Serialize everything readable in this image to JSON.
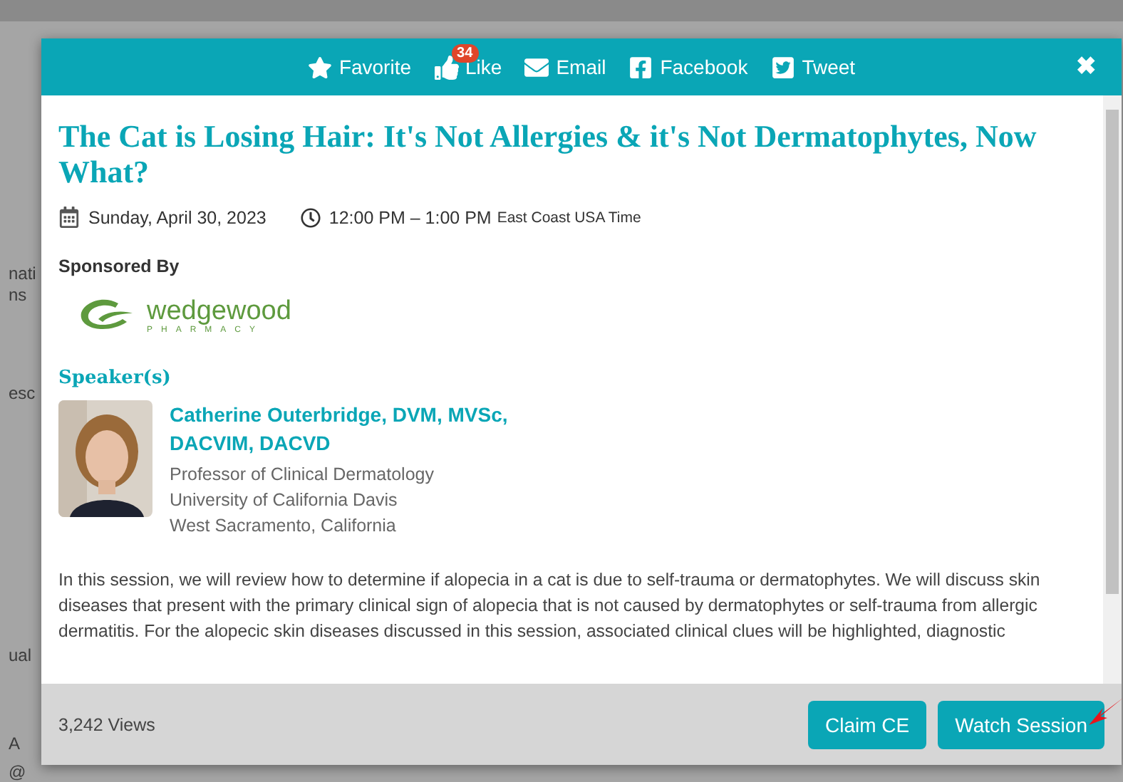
{
  "background": {
    "fragments": [
      "nati",
      "ns",
      "esc",
      "ual",
      "A",
      "@"
    ]
  },
  "modal": {
    "actions": [
      {
        "kind": "favorite",
        "label": "Favorite"
      },
      {
        "kind": "like",
        "label": "Like",
        "count": "34"
      },
      {
        "kind": "email",
        "label": "Email"
      },
      {
        "kind": "facebook",
        "label": "Facebook"
      },
      {
        "kind": "tweet",
        "label": "Tweet"
      }
    ],
    "close": "✖",
    "title": "The Cat is Losing Hair: It's Not Allergies & it's Not Dermatophytes, Now What?",
    "date": "Sunday, April 30, 2023",
    "time": "12:00 PM – 1:00 PM",
    "timezone": "East Coast USA Time",
    "sponsored_heading": "Sponsored By",
    "sponsor": {
      "name": "wedgewood",
      "sub": "PHARMACY"
    },
    "speakers_heading": "Speaker(s)",
    "speakers": [
      {
        "name": "Catherine Outerbridge, DVM, MVSc, DACVIM, DACVD",
        "lines": [
          "Professor of Clinical Dermatology",
          "University of California Davis",
          "West Sacramento, California"
        ]
      }
    ],
    "description": "In this session, we will review how to determine if alopecia in a cat is due to self-trauma or dermatophytes. We will discuss skin diseases that present with the primary clinical sign of alopecia that is not caused by dermatophytes or self-trauma from allergic dermatitis. For the alopecic skin diseases discussed in this session, associated clinical clues will be highlighted, diagnostic",
    "views": "3,242 Views",
    "buttons": [
      "Claim CE",
      "Watch Session"
    ]
  }
}
